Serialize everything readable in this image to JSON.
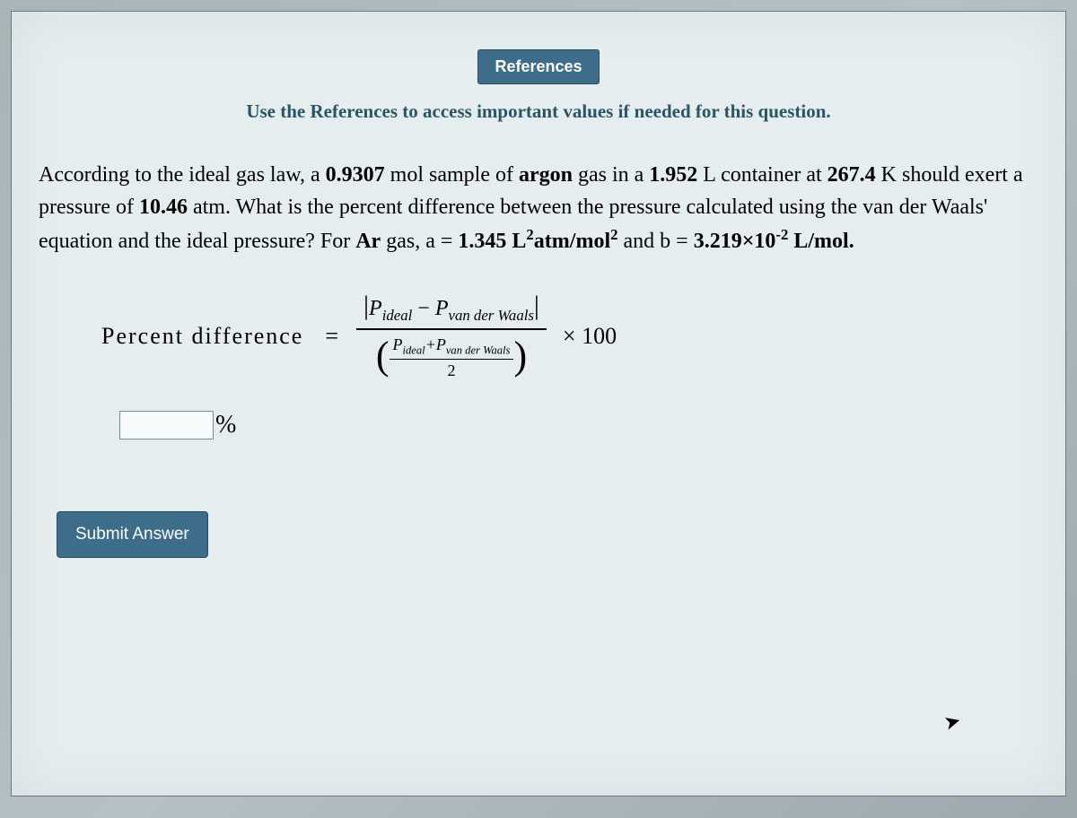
{
  "header": {
    "references_label": "References",
    "instruction": "Use the References to access important values if needed for this question."
  },
  "question": {
    "text_parts": {
      "p1": "According to the ideal gas law, a ",
      "mol": "0.9307",
      "p2": " mol sample of ",
      "gas": "argon",
      "p3": " gas in a ",
      "vol": "1.952",
      "p4": " L container at ",
      "temp": "267.4",
      "p5": " K should exert a pressure of ",
      "pressure": "10.46",
      "p6": " atm. What is the percent difference between the pressure calculated using the van der Waals' equation and the ideal pressure? For ",
      "gas_symbol": "Ar",
      "p7": " gas, a = ",
      "a_val": "1.345",
      "a_units_pre": " L",
      "a_units_sup": "2",
      "a_units_mid": "atm/mol",
      "a_units_sup2": "2",
      "p8": " and b = ",
      "b_val": "3.219×10",
      "b_exp": "-2",
      "b_units": " L/mol."
    }
  },
  "formula": {
    "label": "Percent  difference",
    "equals": "=",
    "numerator": {
      "abs_l": "|",
      "P": "P",
      "ideal_sub": "ideal",
      "minus": " − ",
      "P2": "P",
      "vdw_sub": "van  der  Waals",
      "abs_r": "|"
    },
    "denominator": {
      "lp": "(",
      "inner_num_P": "P",
      "inner_num_ideal": "ideal",
      "inner_num_plus": "+",
      "inner_num_P2": "P",
      "inner_num_vdw": "van  der  Waals",
      "inner_den": "2",
      "rp": ")"
    },
    "times100": "× 100"
  },
  "input": {
    "value": "",
    "unit": "%"
  },
  "submit": {
    "label": "Submit Answer"
  }
}
